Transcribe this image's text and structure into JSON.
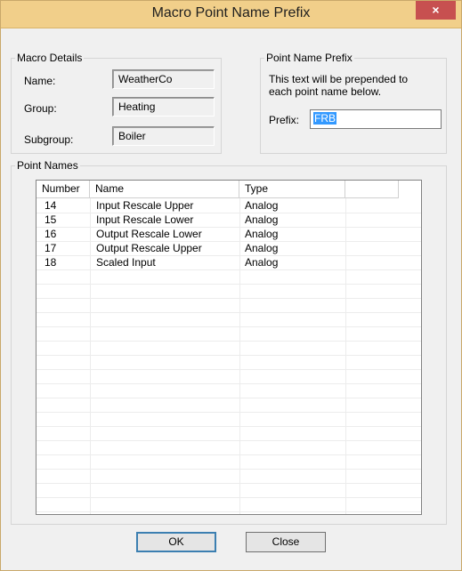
{
  "window": {
    "title": "Macro Point Name Prefix",
    "close_symbol": "×"
  },
  "macro_details": {
    "legend": "Macro Details",
    "name_label": "Name:",
    "name_value": "WeatherCo",
    "group_label": "Group:",
    "group_value": "Heating",
    "subgroup_label": "Subgroup:",
    "subgroup_value": "Boiler"
  },
  "prefix_group": {
    "legend": "Point Name Prefix",
    "description_line1": "This text will be prepended to",
    "description_line2": "each point name below.",
    "prefix_label": "Prefix:",
    "prefix_value": "FRB"
  },
  "point_names": {
    "legend": "Point Names",
    "columns": [
      "Number",
      "Name",
      "Type"
    ],
    "rows": [
      {
        "number": "14",
        "name": "Input Rescale Upper",
        "type": "Analog"
      },
      {
        "number": "15",
        "name": "Input Rescale Lower",
        "type": "Analog"
      },
      {
        "number": "16",
        "name": "Output Rescale Lower",
        "type": "Analog"
      },
      {
        "number": "17",
        "name": "Output Rescale Upper",
        "type": "Analog"
      },
      {
        "number": "18",
        "name": "Scaled Input",
        "type": "Analog"
      }
    ]
  },
  "buttons": {
    "ok": "OK",
    "close": "Close"
  }
}
